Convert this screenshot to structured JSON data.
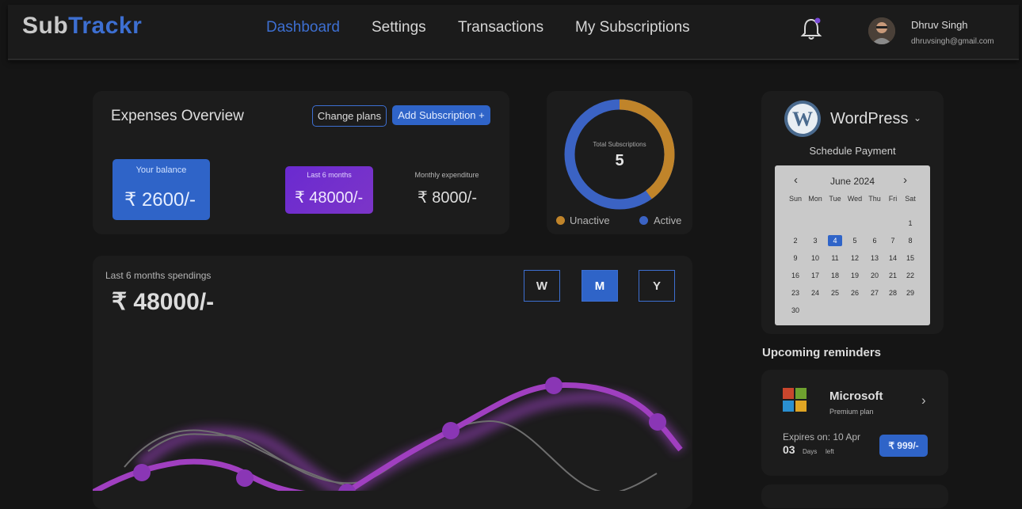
{
  "brand": {
    "part1": "Sub",
    "part2": "Trackr"
  },
  "nav": [
    {
      "label": "Dashboard",
      "active": true
    },
    {
      "label": "Settings",
      "active": false
    },
    {
      "label": "Transactions",
      "active": false
    },
    {
      "label": "My Subscriptions",
      "active": false
    }
  ],
  "user": {
    "name": "Dhruv Singh",
    "email": "dhruvsingh@gmail.com"
  },
  "overview": {
    "title": "Expenses Overview",
    "change_plans": "Change plans",
    "add_subscription": "Add Subscription +",
    "balance_label": "Your balance",
    "balance_value": "₹ 2600/-",
    "six_months_label": "Last 6 months",
    "six_months_value": "₹ 48000/-",
    "monthly_label": "Monthly expenditure",
    "monthly_value": "₹ 8000/-"
  },
  "donut": {
    "center_label": "Total Subscriptions",
    "center_value": "5",
    "legend_inactive": "Unactive",
    "legend_active": "Active",
    "inactive_fraction": 0.4,
    "active_fraction": 0.6,
    "color_inactive": "#c0842a",
    "color_active": "#3b63c4"
  },
  "spendings": {
    "label": "Last 6 months spendings",
    "value": "₹ 48000/-",
    "period_buttons": [
      "W",
      "M",
      "Y"
    ],
    "selected_period": "M"
  },
  "payment": {
    "service": "WordPress",
    "schedule_label": "Schedule Payment",
    "month": "June 2024",
    "weekdays": [
      "Sun",
      "Mon",
      "Tue",
      "Wed",
      "Thu",
      "Fri",
      "Sat"
    ],
    "days": [
      "1",
      "2",
      "3",
      "4",
      "5",
      "6",
      "7",
      "8",
      "9",
      "10",
      "11",
      "12",
      "13",
      "14",
      "15",
      "16",
      "17",
      "18",
      "19",
      "20",
      "21",
      "22",
      "23",
      "24",
      "25",
      "26",
      "27",
      "28",
      "29",
      "30"
    ],
    "selected_day": "4"
  },
  "reminders": {
    "title": "Upcoming reminders",
    "item": {
      "name": "Microsoft",
      "plan": "Premium plan",
      "expires": "Expires on: 10 Apr",
      "days_count": "03",
      "days_word": "Days",
      "left_word": "left",
      "price": "₹ 999/-"
    }
  },
  "colors": {
    "accent": "#2f64c8",
    "purple": "#a03fc0",
    "background": "#151515",
    "card": "#1c1c1c"
  }
}
